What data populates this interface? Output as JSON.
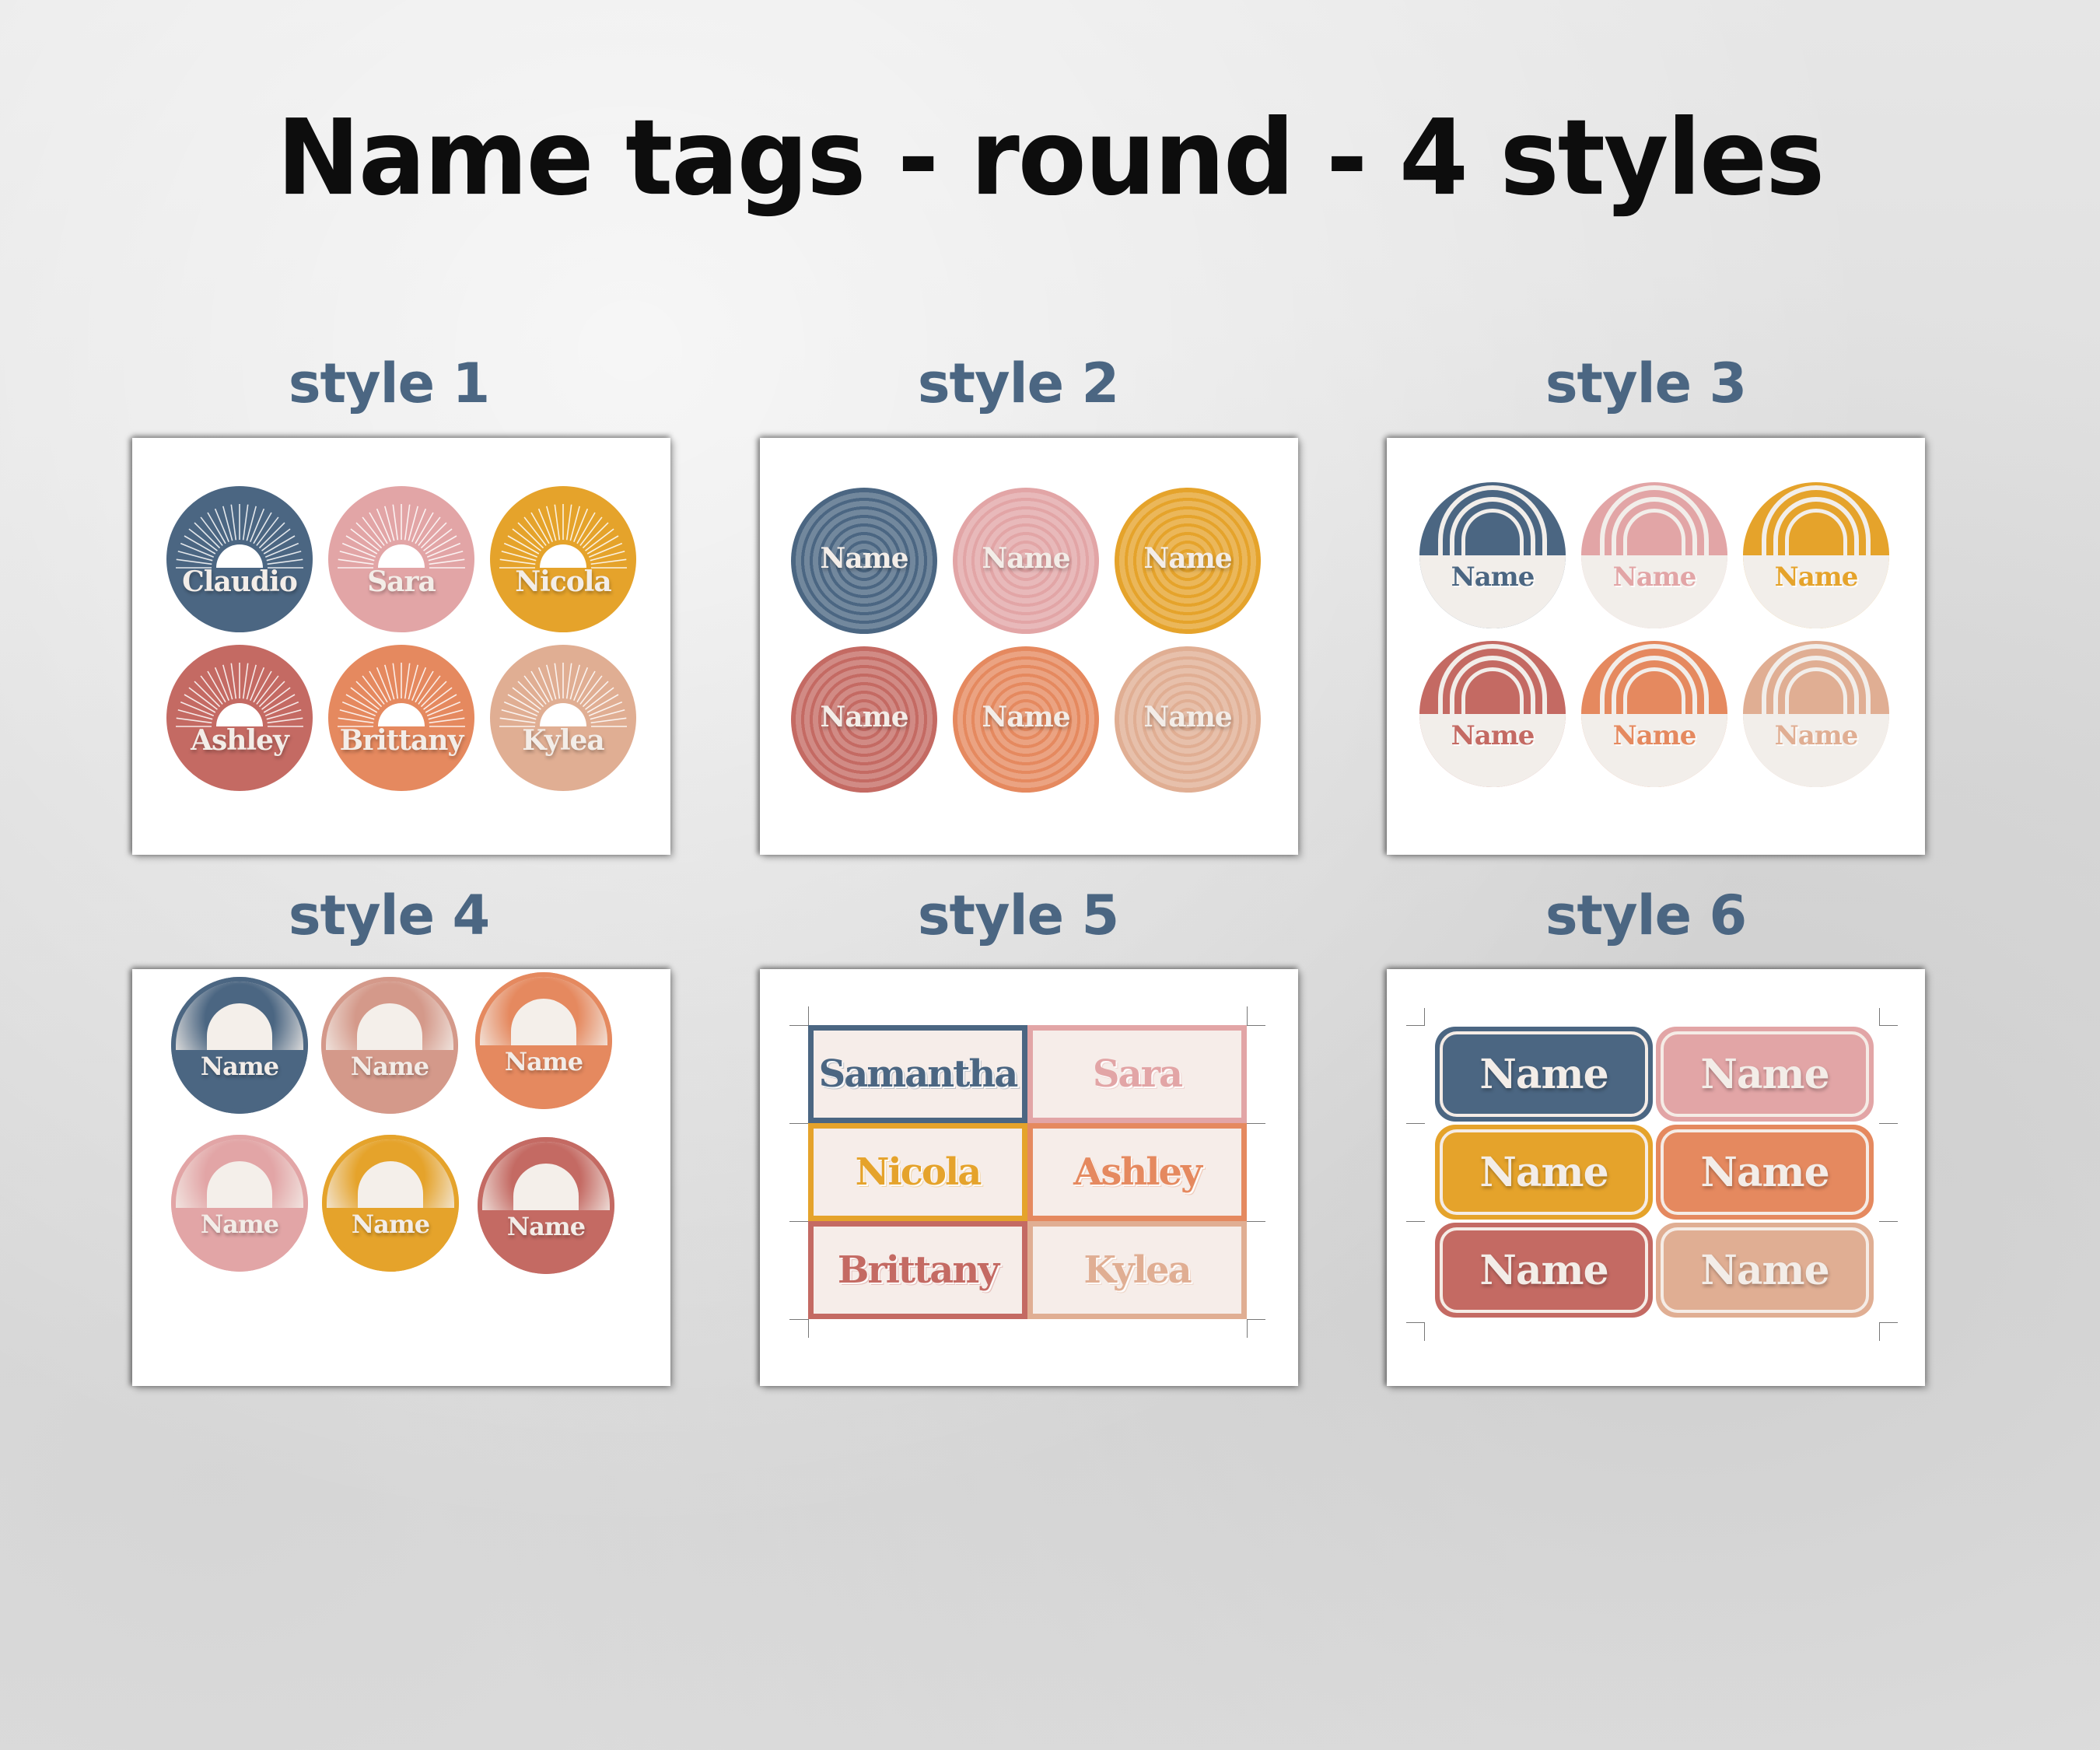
{
  "title": "Name tags - round -  4 styles",
  "palette": {
    "navy": "#4b6682",
    "pink": "#e2a5a6",
    "mustard": "#e5a32b",
    "rose": "#c46a63",
    "orange": "#e5895f",
    "peach": "#e0ae93",
    "cream": "#f2eeea",
    "tan": "#d4998a"
  },
  "styles": [
    {
      "label": "style 1",
      "kind": "sunburst-circle",
      "tags": [
        {
          "name": "Claudio",
          "color": "navy"
        },
        {
          "name": "Sara",
          "color": "pink"
        },
        {
          "name": "Nicola",
          "color": "mustard"
        },
        {
          "name": "Ashley",
          "color": "rose"
        },
        {
          "name": "Brittany",
          "color": "orange"
        },
        {
          "name": "Kylea",
          "color": "peach"
        }
      ]
    },
    {
      "label": "style 2",
      "kind": "concentric-circle",
      "tags": [
        {
          "name": "Name",
          "color": "navy"
        },
        {
          "name": "Name",
          "color": "pink"
        },
        {
          "name": "Name",
          "color": "mustard"
        },
        {
          "name": "Name",
          "color": "rose"
        },
        {
          "name": "Name",
          "color": "orange"
        },
        {
          "name": "Name",
          "color": "peach"
        }
      ]
    },
    {
      "label": "style 3",
      "kind": "rainbow-circle",
      "tags": [
        {
          "name": "Name",
          "color": "navy"
        },
        {
          "name": "Name",
          "color": "pink"
        },
        {
          "name": "Name",
          "color": "mustard"
        },
        {
          "name": "Name",
          "color": "rose"
        },
        {
          "name": "Name",
          "color": "orange"
        },
        {
          "name": "Name",
          "color": "peach"
        }
      ]
    },
    {
      "label": "style 4",
      "kind": "glow-arch-circle",
      "tags": [
        {
          "name": "Name",
          "color": "navy"
        },
        {
          "name": "Name",
          "color": "tan"
        },
        {
          "name": "Name",
          "color": "orange"
        },
        {
          "name": "Name",
          "color": "pink"
        },
        {
          "name": "Name",
          "color": "mustard"
        },
        {
          "name": "Name",
          "color": "rose"
        }
      ]
    },
    {
      "label": "style 5",
      "kind": "bordered-rectangle",
      "tags": [
        {
          "name": "Samantha",
          "color": "navy"
        },
        {
          "name": "Sara",
          "color": "pink"
        },
        {
          "name": "Nicola",
          "color": "mustard"
        },
        {
          "name": "Ashley",
          "color": "orange"
        },
        {
          "name": "Brittany",
          "color": "rose"
        },
        {
          "name": "Kylea",
          "color": "peach"
        }
      ]
    },
    {
      "label": "style 6",
      "kind": "rounded-rectangle",
      "tags": [
        {
          "name": "Name",
          "color": "navy"
        },
        {
          "name": "Name",
          "color": "pink"
        },
        {
          "name": "Name",
          "color": "mustard"
        },
        {
          "name": "Name",
          "color": "orange"
        },
        {
          "name": "Name",
          "color": "rose"
        },
        {
          "name": "Name",
          "color": "peach"
        }
      ]
    }
  ]
}
